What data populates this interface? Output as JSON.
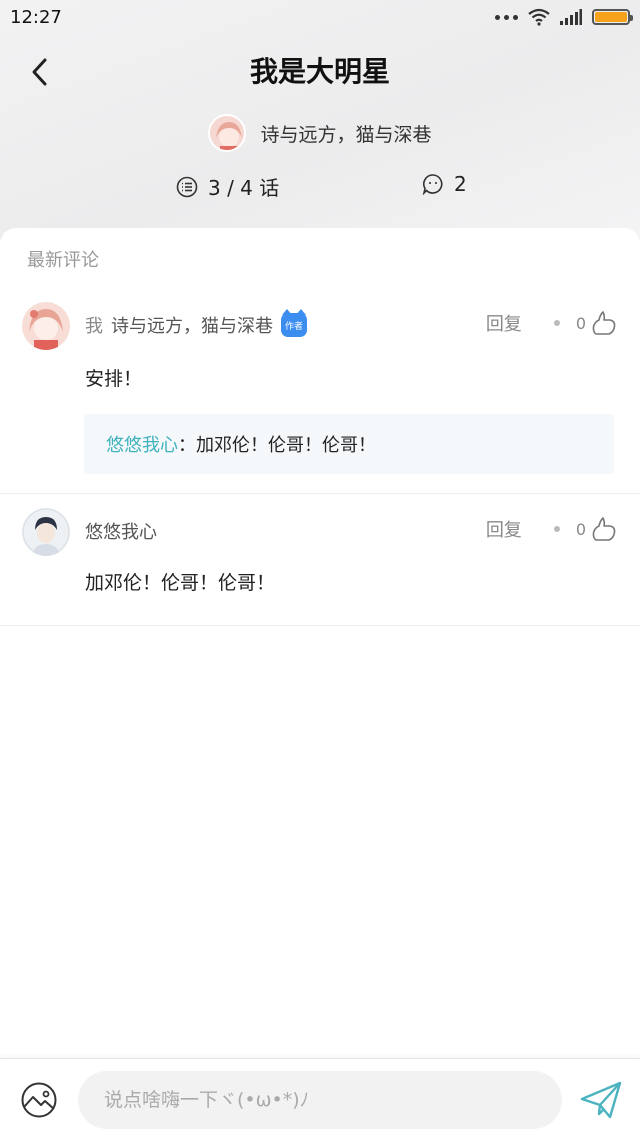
{
  "status_bar": {
    "time": "12:27"
  },
  "header": {
    "title": "我是大明星",
    "author_name": "诗与远方，猫与深巷",
    "chapters": "3 / 4 话",
    "comment_count": "2"
  },
  "section_title": "最新评论",
  "comments": [
    {
      "me_prefix": "我",
      "user": "诗与远方，猫与深巷",
      "author_tag": "作者",
      "reply_label": "回复",
      "likes": "0",
      "text": "安排！",
      "reply": {
        "user": "悠悠我心",
        "separator": "：",
        "text": "加邓伦！伦哥！伦哥！"
      }
    },
    {
      "user": "悠悠我心",
      "reply_label": "回复",
      "likes": "0",
      "text": "加邓伦！伦哥！伦哥！"
    }
  ],
  "input": {
    "placeholder": "说点啥嗨一下ヾ(•ω•*)ﾉ"
  },
  "colors": {
    "accent_teal": "#3fb2bd",
    "author_tag_blue": "#3b8df0",
    "battery_orange": "#f7a21b"
  },
  "icons": [
    "back-icon",
    "chapters-list-icon",
    "comment-bubble-icon",
    "like-icon",
    "image-icon",
    "send-icon",
    "wifi-icon",
    "signal-icon",
    "battery-icon"
  ]
}
